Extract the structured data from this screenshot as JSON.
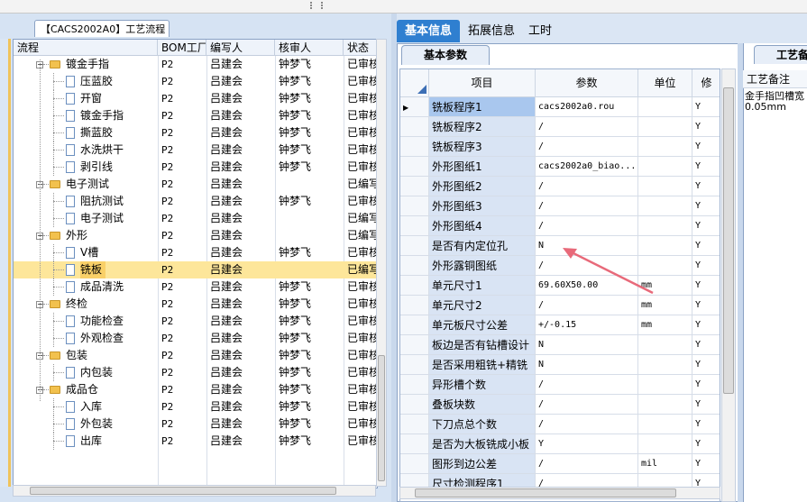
{
  "left_panel": {
    "title": "【CACS2002A0】工艺流程",
    "columns": [
      "流程",
      "BOM工厂",
      "编写人",
      "核审人",
      "状态"
    ],
    "rows": [
      {
        "name": "镀金手指",
        "level": 1,
        "type": "group",
        "bom": "P2",
        "author": "吕建会",
        "reviewer": "钟梦飞",
        "status": "已审核"
      },
      {
        "name": "压蓝胶",
        "level": 2,
        "type": "item",
        "bom": "P2",
        "author": "吕建会",
        "reviewer": "钟梦飞",
        "status": "已审核"
      },
      {
        "name": "开窗",
        "level": 2,
        "type": "item",
        "bom": "P2",
        "author": "吕建会",
        "reviewer": "钟梦飞",
        "status": "已审核"
      },
      {
        "name": "镀金手指",
        "level": 2,
        "type": "item",
        "bom": "P2",
        "author": "吕建会",
        "reviewer": "钟梦飞",
        "status": "已审核"
      },
      {
        "name": "撕蓝胶",
        "level": 2,
        "type": "item",
        "bom": "P2",
        "author": "吕建会",
        "reviewer": "钟梦飞",
        "status": "已审核"
      },
      {
        "name": "水洗烘干",
        "level": 2,
        "type": "item",
        "bom": "P2",
        "author": "吕建会",
        "reviewer": "钟梦飞",
        "status": "已审核"
      },
      {
        "name": "剥引线",
        "level": 2,
        "type": "item",
        "bom": "P2",
        "author": "吕建会",
        "reviewer": "钟梦飞",
        "status": "已审核"
      },
      {
        "name": "电子测试",
        "level": 1,
        "type": "group",
        "bom": "P2",
        "author": "吕建会",
        "reviewer": "",
        "status": "已编写"
      },
      {
        "name": "阻抗测试",
        "level": 2,
        "type": "item",
        "bom": "P2",
        "author": "吕建会",
        "reviewer": "钟梦飞",
        "status": "已审核"
      },
      {
        "name": "电子测试",
        "level": 2,
        "type": "item",
        "bom": "P2",
        "author": "吕建会",
        "reviewer": "",
        "status": "已编写"
      },
      {
        "name": "外形",
        "level": 1,
        "type": "group",
        "bom": "P2",
        "author": "吕建会",
        "reviewer": "",
        "status": "已编写"
      },
      {
        "name": "V槽",
        "level": 2,
        "type": "item",
        "bom": "P2",
        "author": "吕建会",
        "reviewer": "钟梦飞",
        "status": "已审核"
      },
      {
        "name": "铣板",
        "level": 2,
        "type": "item",
        "bom": "P2",
        "author": "吕建会",
        "reviewer": "",
        "status": "已编写",
        "selected": true
      },
      {
        "name": "成品清洗",
        "level": 2,
        "type": "item",
        "bom": "P2",
        "author": "吕建会",
        "reviewer": "钟梦飞",
        "status": "已审核"
      },
      {
        "name": "终检",
        "level": 1,
        "type": "group",
        "bom": "P2",
        "author": "吕建会",
        "reviewer": "钟梦飞",
        "status": "已审核"
      },
      {
        "name": "功能检查",
        "level": 2,
        "type": "item",
        "bom": "P2",
        "author": "吕建会",
        "reviewer": "钟梦飞",
        "status": "已审核"
      },
      {
        "name": "外观检查",
        "level": 2,
        "type": "item",
        "bom": "P2",
        "author": "吕建会",
        "reviewer": "钟梦飞",
        "status": "已审核"
      },
      {
        "name": "包装",
        "level": 1,
        "type": "group",
        "bom": "P2",
        "author": "吕建会",
        "reviewer": "钟梦飞",
        "status": "已审核"
      },
      {
        "name": "内包装",
        "level": 2,
        "type": "item",
        "bom": "P2",
        "author": "吕建会",
        "reviewer": "钟梦飞",
        "status": "已审核"
      },
      {
        "name": "成品仓",
        "level": 1,
        "type": "group",
        "bom": "P2",
        "author": "吕建会",
        "reviewer": "钟梦飞",
        "status": "已审核"
      },
      {
        "name": "入库",
        "level": 2,
        "type": "item",
        "bom": "P2",
        "author": "吕建会",
        "reviewer": "钟梦飞",
        "status": "已审核"
      },
      {
        "name": "外包装",
        "level": 2,
        "type": "item",
        "bom": "P2",
        "author": "吕建会",
        "reviewer": "钟梦飞",
        "status": "已审核"
      },
      {
        "name": "出库",
        "level": 2,
        "type": "item",
        "bom": "P2",
        "author": "吕建会",
        "reviewer": "钟梦飞",
        "status": "已审核"
      }
    ]
  },
  "tabs": [
    "基本信息",
    "拓展信息",
    "工时"
  ],
  "active_tab": "基本信息",
  "params_panel": {
    "subtab": "基本参数",
    "columns": [
      "项目",
      "参数",
      "单位",
      "修"
    ],
    "rows": [
      {
        "item": "铣板程序1",
        "value": "cacs2002a0.rou",
        "unit": "",
        "flag": "Y",
        "current": true
      },
      {
        "item": "铣板程序2",
        "value": "/",
        "unit": "",
        "flag": "Y"
      },
      {
        "item": "铣板程序3",
        "value": "/",
        "unit": "",
        "flag": "Y"
      },
      {
        "item": "外形图纸1",
        "value": "cacs2002a0_biao...",
        "unit": "",
        "flag": "Y"
      },
      {
        "item": "外形图纸2",
        "value": "/",
        "unit": "",
        "flag": "Y"
      },
      {
        "item": "外形图纸3",
        "value": "/",
        "unit": "",
        "flag": "Y"
      },
      {
        "item": "外形图纸4",
        "value": "/",
        "unit": "",
        "flag": "Y"
      },
      {
        "item": "是否有内定位孔",
        "value": "N",
        "unit": "",
        "flag": "Y"
      },
      {
        "item": "外形露铜图纸",
        "value": "/",
        "unit": "",
        "flag": "Y"
      },
      {
        "item": "单元尺寸1",
        "value": "69.60X50.00",
        "unit": "mm",
        "flag": "Y"
      },
      {
        "item": "单元尺寸2",
        "value": "/",
        "unit": "mm",
        "flag": "Y"
      },
      {
        "item": "单元板尺寸公差",
        "value": "+/-0.15",
        "unit": "mm",
        "flag": "Y"
      },
      {
        "item": "板边是否有钻槽设计",
        "value": "N",
        "unit": "",
        "flag": "Y"
      },
      {
        "item": "是否采用粗铣+精铣",
        "value": "N",
        "unit": "",
        "flag": "Y"
      },
      {
        "item": "异形槽个数",
        "value": "/",
        "unit": "",
        "flag": "Y"
      },
      {
        "item": "叠板块数",
        "value": "/",
        "unit": "",
        "flag": "Y"
      },
      {
        "item": "下刀点总个数",
        "value": "/",
        "unit": "",
        "flag": "Y"
      },
      {
        "item": "是否为大板铣成小板",
        "value": "Y",
        "unit": "",
        "flag": "Y"
      },
      {
        "item": "图形到边公差",
        "value": "/",
        "unit": "mil",
        "flag": "Y"
      },
      {
        "item": "尺寸检测程序1",
        "value": "/",
        "unit": "",
        "flag": "Y"
      }
    ]
  },
  "notes_panel": {
    "tab": "工艺备注",
    "header": "工艺备注",
    "lines": [
      "金手指凹槽宽",
      "0.05mm"
    ]
  },
  "colors": {
    "accent": "#2f7fd0",
    "selected_row": "#fde69a",
    "annotation_arrow": "#e86a7a"
  }
}
